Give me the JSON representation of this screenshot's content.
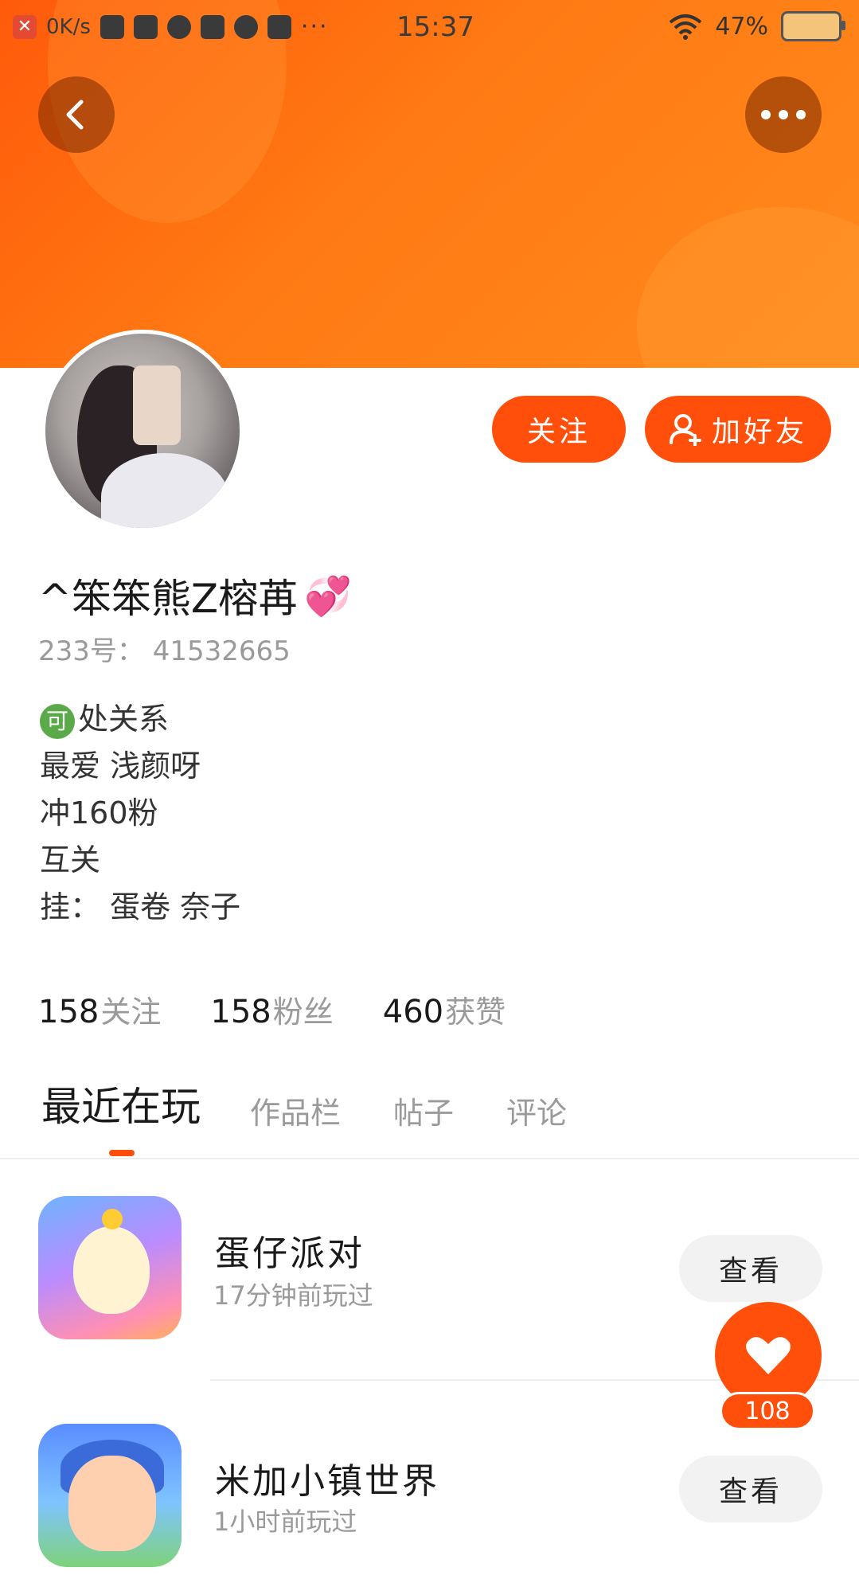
{
  "status_bar": {
    "net_speed": "0K/s",
    "time": "15:37",
    "battery": "47%",
    "more_indicator": "···"
  },
  "header": {
    "back_icon": "chevron-left-icon",
    "more_icon": "more-horizontal-icon"
  },
  "profile": {
    "follow_label": "关注",
    "add_friend_label": "加好友",
    "nickname": "^笨笨熊Z榕苒",
    "nickname_emoji": "💞",
    "uid_text": "233号： 41532665",
    "bio": {
      "badge": "可",
      "line1": "处关系",
      "line2": "最爱 浅颜呀",
      "line3": "冲160粉",
      "line4": "互关",
      "line5": "挂： 蛋卷 奈子"
    },
    "stats": [
      {
        "num": "158",
        "label": "关注"
      },
      {
        "num": "158",
        "label": "粉丝"
      },
      {
        "num": "460",
        "label": "获赞"
      }
    ]
  },
  "tabs": [
    "最近在玩",
    "作品栏",
    "帖子",
    "评论"
  ],
  "active_tab": 0,
  "games": [
    {
      "title": "蛋仔派对",
      "subtitle": "17分钟前玩过",
      "action": "查看"
    },
    {
      "title": "米加小镇世界",
      "subtitle": "1小时前玩过",
      "action": "查看"
    }
  ],
  "like_fab": {
    "count": "108"
  },
  "colors": {
    "accent": "#ff4f0a",
    "banner_start": "#ff5a0a",
    "banner_end": "#ff8a1c"
  }
}
